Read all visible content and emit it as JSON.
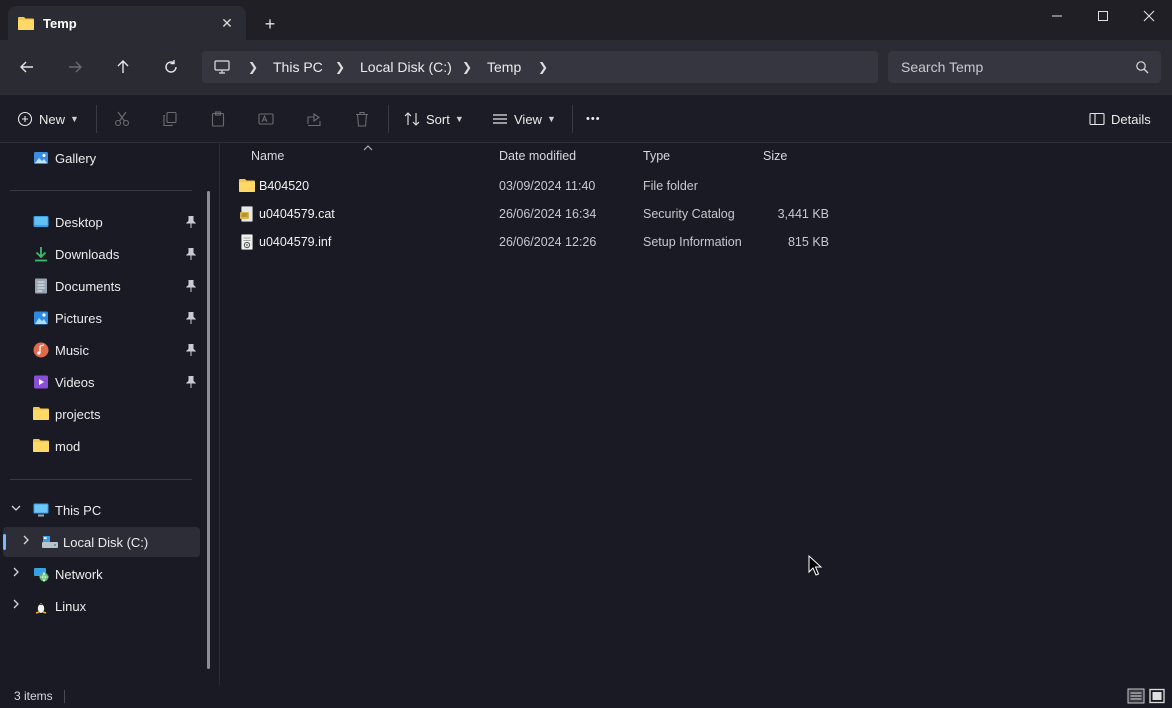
{
  "window": {
    "tab_title": "Temp",
    "tab_close": "✕",
    "new_tab": "+"
  },
  "nav": {
    "breadcrumbs": [
      "This PC",
      "Local Disk (C:)",
      "Temp"
    ],
    "search_placeholder": "Search Temp"
  },
  "toolbar": {
    "new_label": "New",
    "sort_label": "Sort",
    "view_label": "View",
    "more_label": "•••",
    "details_label": "Details"
  },
  "sidebar": {
    "gallery": "Gallery",
    "quick_access": [
      {
        "label": "Desktop",
        "icon": "desktop-icon",
        "pinned": true
      },
      {
        "label": "Downloads",
        "icon": "downloads-icon",
        "pinned": true
      },
      {
        "label": "Documents",
        "icon": "documents-icon",
        "pinned": true
      },
      {
        "label": "Pictures",
        "icon": "pictures-icon",
        "pinned": true
      },
      {
        "label": "Music",
        "icon": "music-icon",
        "pinned": true
      },
      {
        "label": "Videos",
        "icon": "videos-icon",
        "pinned": true
      },
      {
        "label": "projects",
        "icon": "folder-icon",
        "pinned": false
      },
      {
        "label": "mod",
        "icon": "folder-icon",
        "pinned": false
      }
    ],
    "this_pc": "This PC",
    "local_disk": "Local Disk (C:)",
    "network": "Network",
    "linux": "Linux"
  },
  "file_list": {
    "columns": [
      "Name",
      "Date modified",
      "Type",
      "Size"
    ],
    "rows": [
      {
        "name": "B404520",
        "date": "03/09/2024 11:40",
        "type": "File folder",
        "size": "",
        "icon": "folder-icon"
      },
      {
        "name": "u0404579.cat",
        "date": "26/06/2024 16:34",
        "type": "Security Catalog",
        "size": "3,441 KB",
        "icon": "catalog-file-icon"
      },
      {
        "name": "u0404579.inf",
        "date": "26/06/2024 12:26",
        "type": "Setup Information",
        "size": "815 KB",
        "icon": "inf-file-icon"
      }
    ]
  },
  "status": {
    "item_count": "3 items"
  },
  "colors": {
    "background": "#191a24",
    "folder": "#f5c84c",
    "accent": "#7fb4ff"
  }
}
